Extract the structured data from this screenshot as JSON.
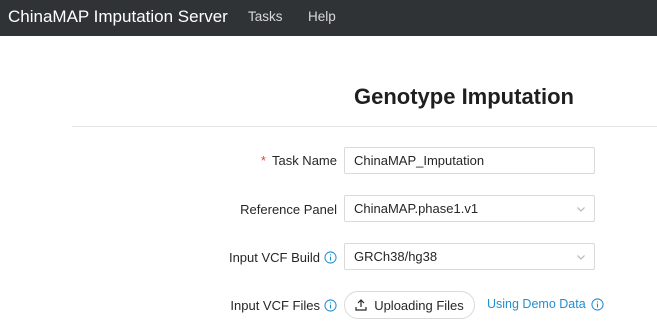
{
  "navbar": {
    "brand": "ChinaMAP Imputation Server",
    "links": [
      "Tasks",
      "Help"
    ]
  },
  "page": {
    "title": "Genotype Imputation"
  },
  "form": {
    "task_name": {
      "required_mark": "*",
      "label": "Task Name",
      "value": "ChinaMAP_Imputation"
    },
    "reference_panel": {
      "label": "Reference Panel",
      "value": "ChinaMAP.phase1.v1"
    },
    "input_vcf_build": {
      "label": "Input VCF Build",
      "value": "GRCh38/hg38"
    },
    "input_vcf_files": {
      "label": "Input VCF Files",
      "upload_label": "Uploading Files",
      "demo_label": "Using Demo Data"
    }
  },
  "icons": {
    "info": "info-circle-icon",
    "chevron": "chevron-down-icon",
    "upload": "upload-icon"
  },
  "colors": {
    "navbar_bg": "#303336",
    "accent": "#1f8fd1",
    "required": "#e0453c"
  }
}
